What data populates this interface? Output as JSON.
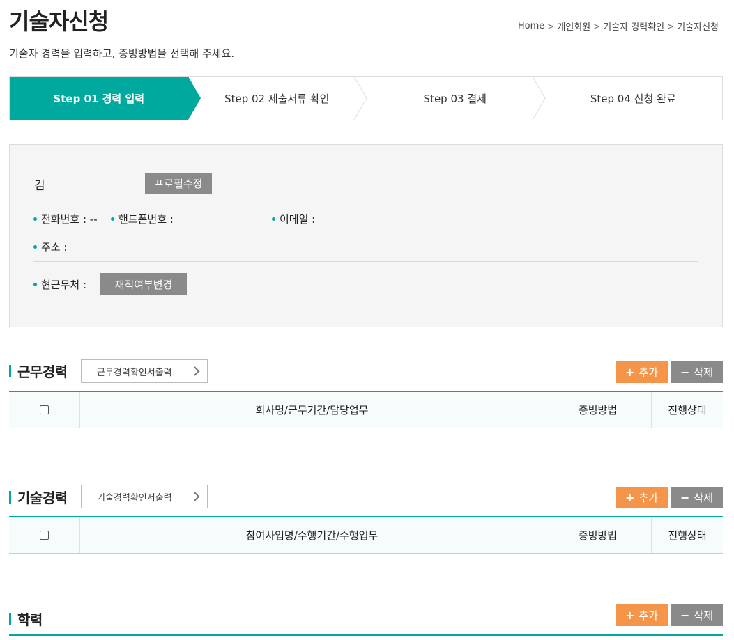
{
  "header": {
    "title": "기술자신청",
    "breadcrumb": [
      "Home",
      "개인회원",
      "기술자 경력확인",
      "기술자신청"
    ],
    "subtitle": "기술자 경력을 입력하고, 증빙방법을 선택해 주세요."
  },
  "steps": [
    {
      "label": "Step 01 경력 입력",
      "active": true
    },
    {
      "label": "Step 02 제출서류 확인",
      "active": false
    },
    {
      "label": "Step 03 결제",
      "active": false
    },
    {
      "label": "Step 04 신청 완료",
      "active": false
    }
  ],
  "profile": {
    "name": "김",
    "edit_label": "프로필수정",
    "phone_label": "전화번호 : --",
    "mobile_label": "핸드폰번호 :",
    "email_label": "이메일 :",
    "address_label": "주소 :",
    "workplace_label": "현근무처 :",
    "status_label": "재직여부변경"
  },
  "sections": {
    "work": {
      "title": "근무경력",
      "print_label": "근무경력확인서출력",
      "columns": [
        "회사명/근무기간/담당업무",
        "증빙방법",
        "진행상태"
      ]
    },
    "tech": {
      "title": "기술경력",
      "print_label": "기술경력확인서출력",
      "columns": [
        "참여사업명/수행기간/수행업무",
        "증빙방법",
        "진행상태"
      ]
    },
    "edu": {
      "title": "학력"
    }
  },
  "actions": {
    "add_label": "추가",
    "delete_label": "삭제",
    "add_icon": "plus-icon",
    "delete_icon": "minus-icon"
  },
  "colors": {
    "accent": "#00a99d",
    "add": "#f5954a",
    "gray": "#8a8a8a"
  }
}
